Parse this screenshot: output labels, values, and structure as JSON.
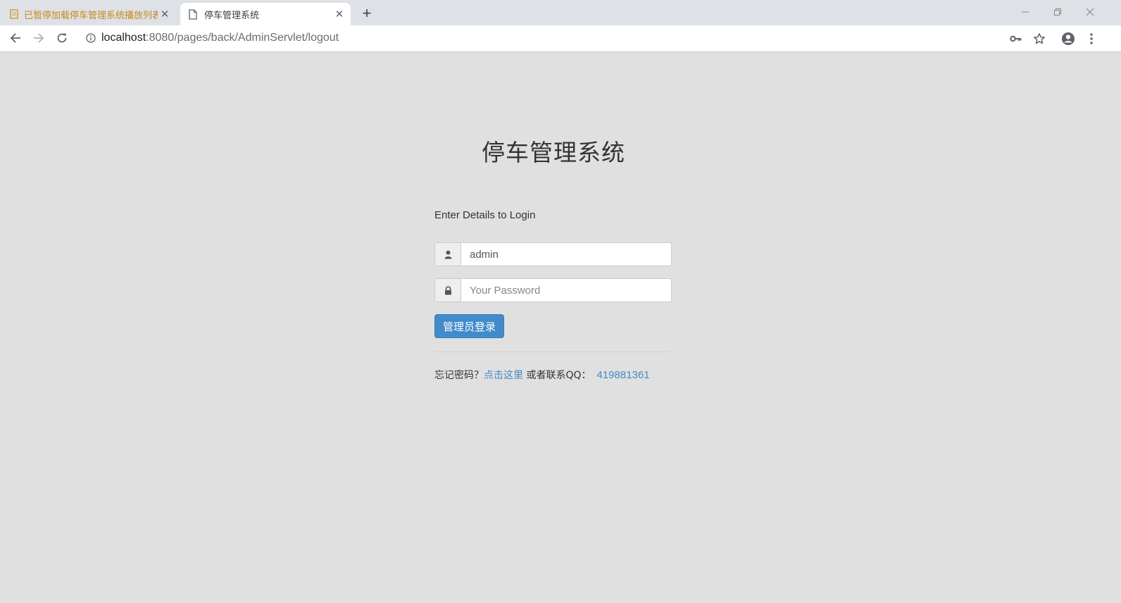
{
  "browser": {
    "tabs": [
      {
        "title": "已暂停加载停车管理系统播放列表",
        "active": false
      },
      {
        "title": "停车管理系统",
        "active": true
      }
    ],
    "new_tab_label": "+",
    "close_glyph": "✕",
    "address": {
      "host": "localhost",
      "path": ":8080/pages/back/AdminServlet/logout"
    },
    "icons": [
      "back-icon",
      "forward-icon",
      "reload-icon",
      "info-icon",
      "key-icon",
      "star-icon",
      "account-icon",
      "menu-icon",
      "minimize-icon",
      "restore-icon",
      "window-close-icon"
    ]
  },
  "page": {
    "title": "停车管理系统",
    "login_heading": "Enter Details to Login",
    "username": {
      "value": "admin",
      "icon": "user-icon"
    },
    "password": {
      "value": "",
      "placeholder": "Your Password",
      "icon": "lock-icon"
    },
    "login_button": "管理员登录",
    "forgot": {
      "prefix": "忘记密码？",
      "link": "点击这里",
      "middle": " 或者联系QQ：",
      "qq": "419881361"
    }
  },
  "colors": {
    "page_background": "#e0e0e0",
    "primary": "#428bca",
    "tab_warning_text": "#c58a1e"
  }
}
